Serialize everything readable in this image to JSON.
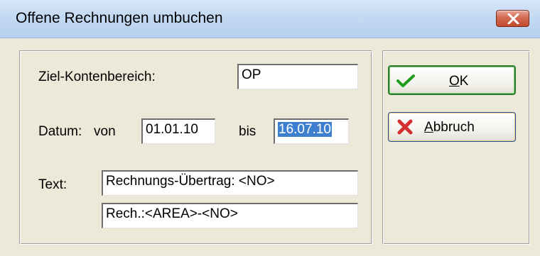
{
  "window": {
    "title": "Offene Rechnungen umbuchen",
    "close_icon": "close-x-icon"
  },
  "form": {
    "ziel": {
      "label": "Ziel-Kontenbereich:",
      "value": "OP"
    },
    "datum": {
      "label": "Datum:",
      "von_label": "von",
      "von_value": "01.01.10",
      "bis_label": "bis",
      "bis_value": "16.07.10",
      "bis_selected": true
    },
    "text": {
      "label": "Text:",
      "line1": "Rechnungs-Übertrag: <NO>",
      "line2": "Rech.:<AREA>-<NO>"
    }
  },
  "buttons": {
    "ok": {
      "mnemonic": "O",
      "rest": "K",
      "icon": "checkmark-icon",
      "is_default": true
    },
    "cancel": {
      "mnemonic": "A",
      "rest": "bbruch",
      "icon": "red-x-icon"
    }
  },
  "colors": {
    "titlebar": "#c2d9f3",
    "dialog_bg": "#ece9d8",
    "selection": "#3f7fd0",
    "close_button": "#d36a52",
    "ok_border": "#2d7a2d",
    "cancel_icon": "#d32f2f",
    "check_icon": "#1f9c1f"
  }
}
